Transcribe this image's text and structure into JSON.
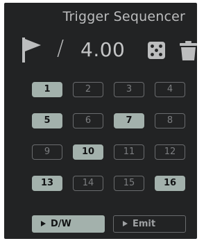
{
  "device": {
    "title": "Trigger Sequencer"
  },
  "controls": {
    "flag_icon": "flag-icon",
    "separator": "/",
    "value": "4.00",
    "dice_icon": "dice-icon",
    "trash_icon": "trash-icon"
  },
  "steps": [
    {
      "label": "1",
      "active": true
    },
    {
      "label": "2",
      "active": false
    },
    {
      "label": "3",
      "active": false
    },
    {
      "label": "4",
      "active": false
    },
    {
      "label": "5",
      "active": true
    },
    {
      "label": "6",
      "active": false
    },
    {
      "label": "7",
      "active": true
    },
    {
      "label": "8",
      "active": false
    },
    {
      "label": "9",
      "active": false
    },
    {
      "label": "10",
      "active": true
    },
    {
      "label": "11",
      "active": false
    },
    {
      "label": "12",
      "active": false
    },
    {
      "label": "13",
      "active": true
    },
    {
      "label": "14",
      "active": false
    },
    {
      "label": "15",
      "active": false
    },
    {
      "label": "16",
      "active": true
    }
  ],
  "buttons": {
    "dw_label": "D/W",
    "dw_active": true,
    "emit_label": "Emit",
    "emit_active": false
  },
  "colors": {
    "panel_bg": "#222324",
    "active_fill": "#a3b1ac",
    "inactive_border": "#6a6c6e",
    "text": "#bcbdbe"
  }
}
